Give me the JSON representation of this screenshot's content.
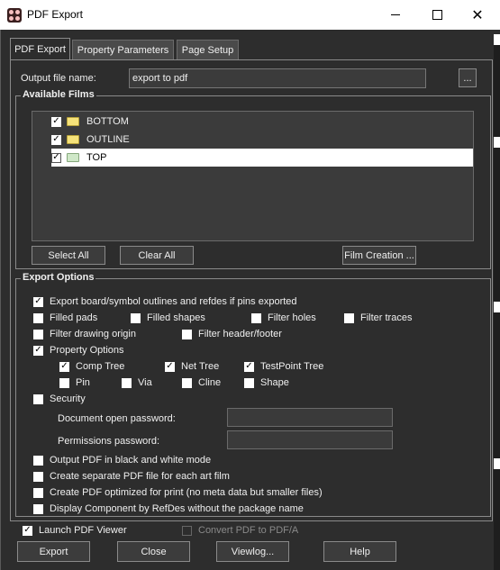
{
  "window": {
    "title": "PDF Export"
  },
  "tabs": [
    {
      "label": "PDF Export",
      "active": true
    },
    {
      "label": "Property Parameters",
      "active": false
    },
    {
      "label": "Page Setup",
      "active": false
    }
  ],
  "output": {
    "label": "Output file name:",
    "value": "export to pdf",
    "browse_label": "..."
  },
  "films": {
    "title": "Available Films",
    "items": [
      {
        "label": "BOTTOM",
        "checked": true,
        "icon": "folder-icon",
        "selected": false
      },
      {
        "label": "OUTLINE",
        "checked": true,
        "icon": "folder-icon",
        "selected": false
      },
      {
        "label": "TOP",
        "checked": true,
        "icon": "folder-icon",
        "selected": true
      }
    ],
    "select_all": "Select All",
    "clear_all": "Clear All",
    "film_creation": "Film Creation ..."
  },
  "export_options": {
    "title": "Export Options",
    "export_outlines": {
      "label": "Export board/symbol outlines and refdes if pins exported",
      "checked": true
    },
    "filled_pads": {
      "label": "Filled pads",
      "checked": false
    },
    "filled_shapes": {
      "label": "Filled shapes",
      "checked": false
    },
    "filter_holes": {
      "label": "Filter holes",
      "checked": false
    },
    "filter_traces": {
      "label": "Filter traces",
      "checked": false
    },
    "filter_drawing_origin": {
      "label": "Filter drawing origin",
      "checked": false
    },
    "filter_header_footer": {
      "label": "Filter header/footer",
      "checked": false
    },
    "property_options": {
      "label": "Property Options",
      "checked": true
    },
    "comp_tree": {
      "label": "Comp Tree",
      "checked": true
    },
    "net_tree": {
      "label": "Net Tree",
      "checked": true
    },
    "testpoint_tree": {
      "label": "TestPoint Tree",
      "checked": true
    },
    "pin": {
      "label": "Pin",
      "checked": false
    },
    "via": {
      "label": "Via",
      "checked": false
    },
    "cline": {
      "label": "Cline",
      "checked": false
    },
    "shape": {
      "label": "Shape",
      "checked": false
    },
    "security": {
      "label": "Security",
      "checked": false
    },
    "doc_open_password": {
      "label": "Document open password:",
      "value": ""
    },
    "permissions_password": {
      "label": "Permissions password:",
      "value": ""
    },
    "black_white": {
      "label": "Output PDF in black and white mode",
      "checked": false
    },
    "separate_pdf": {
      "label": "Create separate PDF file for each art film",
      "checked": false
    },
    "optimized_print": {
      "label": "Create PDF optimized for print (no meta data but smaller files)",
      "checked": false
    },
    "display_refdes": {
      "label": "Display Component by RefDes without the package name",
      "checked": false
    }
  },
  "launch_viewer": {
    "label": "Launch PDF Viewer",
    "checked": true
  },
  "convert_pdfa": {
    "label": "Convert PDF to PDF/A",
    "checked": false,
    "disabled": true
  },
  "buttons": {
    "export": "Export",
    "close": "Close",
    "viewlog": "Viewlog...",
    "help": "Help"
  },
  "colors": {
    "background": "#2d2d2d",
    "titlebar": "#ffffff",
    "selection": "#ffffff",
    "folder": "#f5e27a",
    "folder_selected": "#cfe8c8"
  }
}
